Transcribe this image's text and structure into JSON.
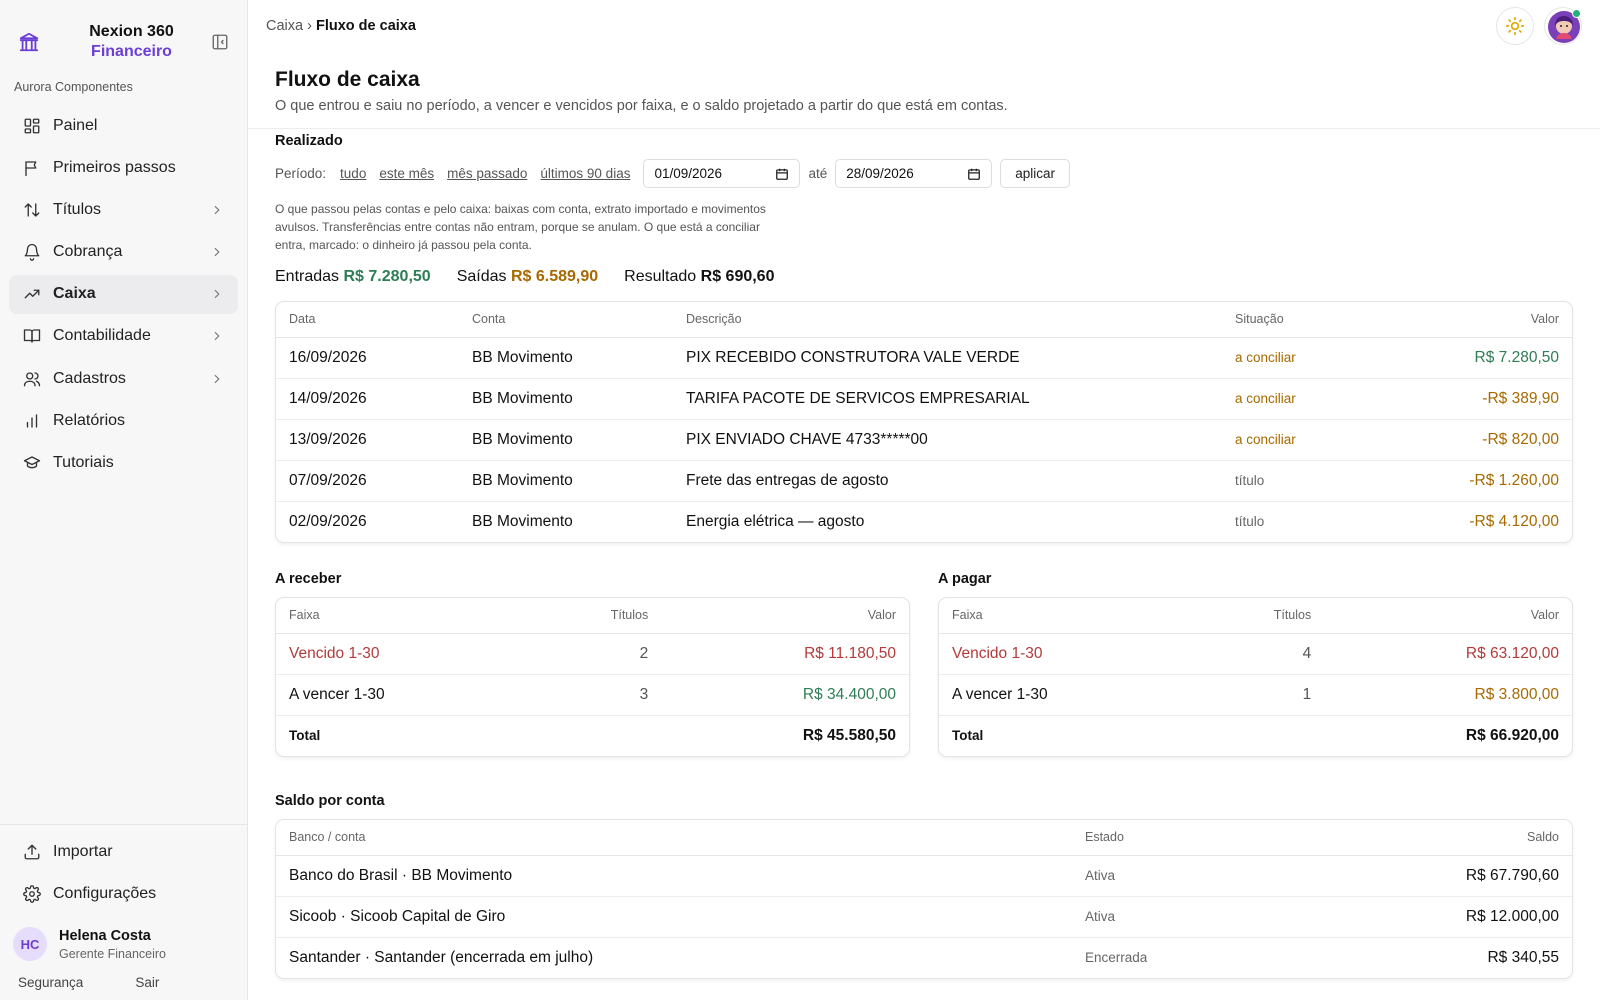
{
  "brand": {
    "name": "Nexion 360",
    "sub": "Financeiro"
  },
  "org": "Aurora Componentes",
  "nav": [
    {
      "label": "Painel",
      "icon": "dashboard-icon",
      "chevron": false,
      "active": false
    },
    {
      "label": "Primeiros passos",
      "icon": "flag-icon",
      "chevron": false,
      "active": false
    },
    {
      "label": "Títulos",
      "icon": "arrows-updown-icon",
      "chevron": true,
      "active": false
    },
    {
      "label": "Cobrança",
      "icon": "bell-icon",
      "chevron": true,
      "active": false
    },
    {
      "label": "Caixa",
      "icon": "trending-up-icon",
      "chevron": true,
      "active": true
    },
    {
      "label": "Contabilidade",
      "icon": "book-icon",
      "chevron": true,
      "active": false
    },
    {
      "label": "Cadastros",
      "icon": "users-icon",
      "chevron": true,
      "active": false
    },
    {
      "label": "Relatórios",
      "icon": "bar-chart-icon",
      "chevron": false,
      "active": false
    },
    {
      "label": "Tutoriais",
      "icon": "graduation-cap-icon",
      "chevron": false,
      "active": false
    }
  ],
  "bottom_nav": [
    {
      "label": "Importar",
      "icon": "upload-icon"
    },
    {
      "label": "Configurações",
      "icon": "gear-icon"
    }
  ],
  "user": {
    "initials": "HC",
    "name": "Helena Costa",
    "role": "Gerente Financeiro",
    "security": "Segurança",
    "logout": "Sair"
  },
  "breadcrumb": {
    "parent": "Caixa",
    "sep": "›",
    "current": "Fluxo de caixa"
  },
  "page": {
    "title": "Fluxo de caixa",
    "subtitle": "O que entrou e saiu no período, a vencer e vencidos por faixa, e o saldo projetado a partir do que está em contas."
  },
  "realizado": {
    "title": "Realizado",
    "period_label": "Período:",
    "period_links": [
      "tudo",
      "este mês",
      "mês passado",
      "últimos 90 dias"
    ],
    "date_from": "01/09/2026",
    "until": "até",
    "date_to": "28/09/2026",
    "apply": "aplicar",
    "note": "O que passou pelas contas e pelo caixa: baixas com conta, extrato importado e movimentos avulsos. Transferências entre contas não entram, porque se anulam. O que está a conciliar entra, marcado: o dinheiro já passou pela conta.",
    "totals": {
      "in_label": "Entradas",
      "in_value": "R$ 7.280,50",
      "out_label": "Saídas",
      "out_value": "R$ 6.589,90",
      "res_label": "Resultado",
      "res_value": "R$ 690,60"
    },
    "headers": {
      "date": "Data",
      "account": "Conta",
      "desc": "Descrição",
      "status": "Situação",
      "value": "Valor"
    },
    "rows": [
      {
        "date": "16/09/2026",
        "account": "BB Movimento",
        "desc": "PIX RECEBIDO CONSTRUTORA VALE VERDE",
        "status": "a conciliar",
        "value": "R$ 7.280,50",
        "kind": "in",
        "st": "conc"
      },
      {
        "date": "14/09/2026",
        "account": "BB Movimento",
        "desc": "TARIFA PACOTE DE SERVICOS EMPRESARIAL",
        "status": "a conciliar",
        "value": "-R$ 389,90",
        "kind": "out",
        "st": "conc"
      },
      {
        "date": "13/09/2026",
        "account": "BB Movimento",
        "desc": "PIX ENVIADO CHAVE 4733*****00",
        "status": "a conciliar",
        "value": "-R$ 820,00",
        "kind": "out",
        "st": "conc"
      },
      {
        "date": "07/09/2026",
        "account": "BB Movimento",
        "desc": "Frete das entregas de agosto",
        "status": "título",
        "value": "-R$ 1.260,00",
        "kind": "out",
        "st": "tit"
      },
      {
        "date": "02/09/2026",
        "account": "BB Movimento",
        "desc": "Energia elétrica — agosto",
        "status": "título",
        "value": "-R$ 4.120,00",
        "kind": "out",
        "st": "tit"
      }
    ]
  },
  "receber": {
    "title": "A receber",
    "headers": {
      "band": "Faixa",
      "count": "Títulos",
      "value": "Valor"
    },
    "rows": [
      {
        "band": "Vencido 1-30",
        "count": "2",
        "value": "R$ 11.180,50",
        "kind": "overdue"
      },
      {
        "band": "A vencer 1-30",
        "count": "3",
        "value": "R$ 34.400,00",
        "kind": "due_in"
      }
    ],
    "total_label": "Total",
    "total_value": "R$ 45.580,50"
  },
  "pagar": {
    "title": "A pagar",
    "headers": {
      "band": "Faixa",
      "count": "Títulos",
      "value": "Valor"
    },
    "rows": [
      {
        "band": "Vencido 1-30",
        "count": "4",
        "value": "R$ 63.120,00",
        "kind": "overdue"
      },
      {
        "band": "A vencer 1-30",
        "count": "1",
        "value": "R$ 3.800,00",
        "kind": "due_out"
      }
    ],
    "total_label": "Total",
    "total_value": "R$ 66.920,00"
  },
  "saldo": {
    "title": "Saldo por conta",
    "headers": {
      "account": "Banco / conta",
      "state": "Estado",
      "balance": "Saldo"
    },
    "rows": [
      {
        "account": "Banco do Brasil · BB Movimento",
        "state": "Ativa",
        "balance": "R$ 67.790,60"
      },
      {
        "account": "Sicoob · Sicoob Capital de Giro",
        "state": "Ativa",
        "balance": "R$ 12.000,00"
      },
      {
        "account": "Santander · Santander (encerrada em julho)",
        "state": "Encerrada",
        "balance": "R$ 340,55"
      }
    ]
  },
  "colors": {
    "accent": "#6b3fd6",
    "green": "#2e7d55",
    "amber": "#a66a00",
    "red": "#b23a3a"
  }
}
